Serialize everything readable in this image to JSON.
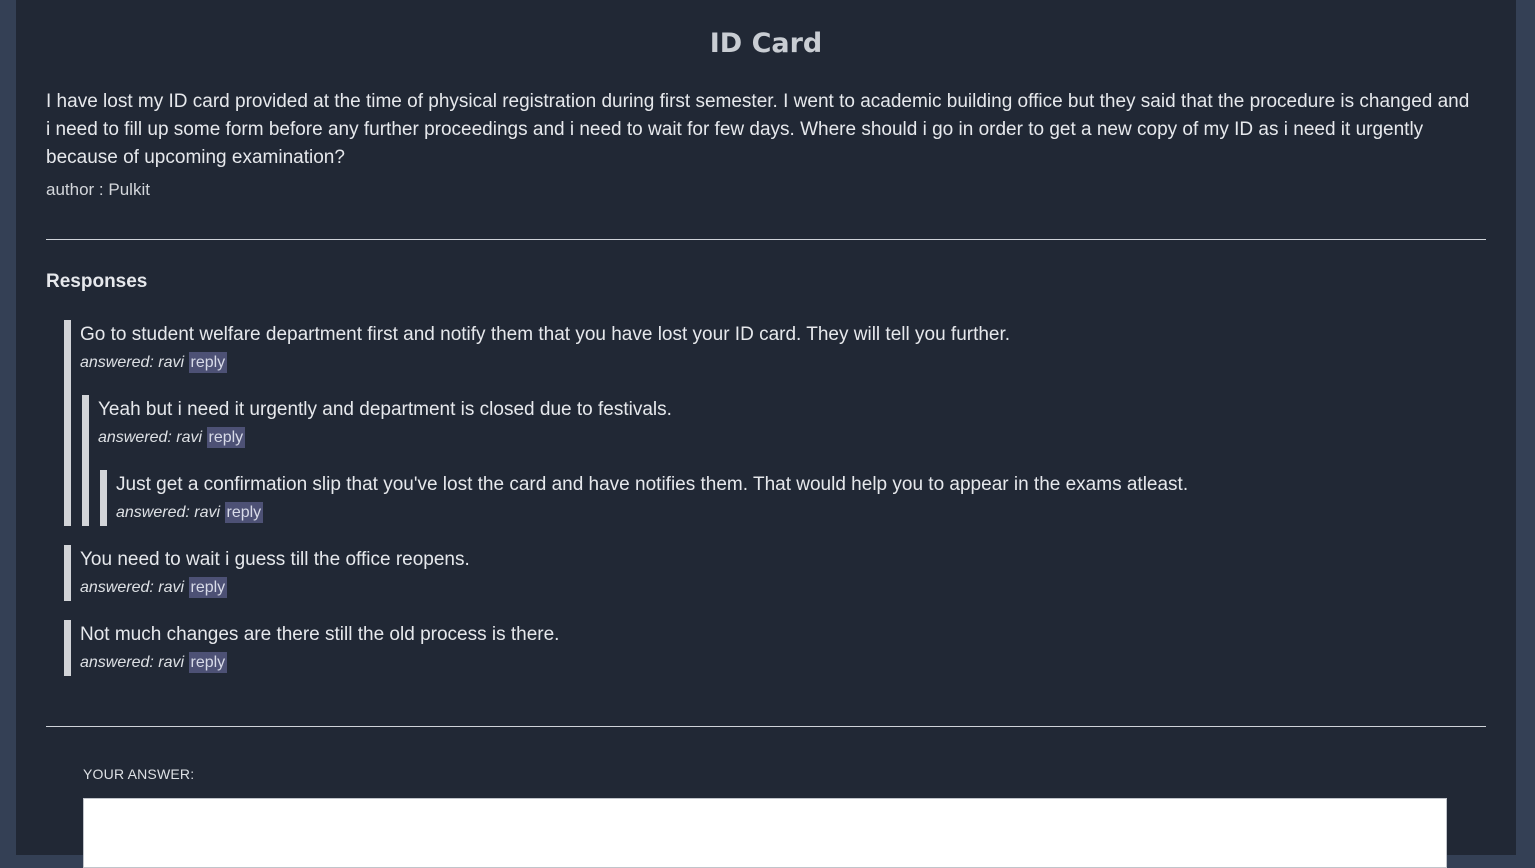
{
  "question": {
    "title": "ID Card",
    "body": "I have lost my ID card provided at the time of physical registration during first semester. I went to academic building office but they said that the procedure is changed and i need to fill up some form before any further proceedings and i need to wait for few days. Where should i go in order to get a new copy of my ID as i need it urgently because of upcoming examination?",
    "author": "author : Pulkit"
  },
  "responses_heading": "Responses",
  "responses": [
    {
      "text": "Go to student welfare department first and notify them that you have lost your ID card. They will tell you further.",
      "meta": "answered: ravi",
      "reply_label": "reply",
      "children": [
        {
          "text": "Yeah but i need it urgently and department is closed due to festivals.",
          "meta": "answered: ravi",
          "reply_label": "reply",
          "children": [
            {
              "text": "Just get a confirmation slip that you've lost the card and have notifies them. That would help you to appear in the exams atleast.",
              "meta": "answered: ravi",
              "reply_label": "reply",
              "children": []
            }
          ]
        }
      ]
    },
    {
      "text": "You need to wait i guess till the office reopens.",
      "meta": "answered: ravi",
      "reply_label": "reply",
      "children": []
    },
    {
      "text": "Not much changes are there still the old process is there.",
      "meta": "answered: ravi",
      "reply_label": "reply",
      "children": []
    }
  ],
  "answer": {
    "label": "YOUR ANSWER:",
    "value": ""
  },
  "colors": {
    "page_background": "#344055",
    "panel_background": "#212835",
    "reply_highlight": "#4d5175",
    "thread_bar": "#d2d4d8"
  }
}
